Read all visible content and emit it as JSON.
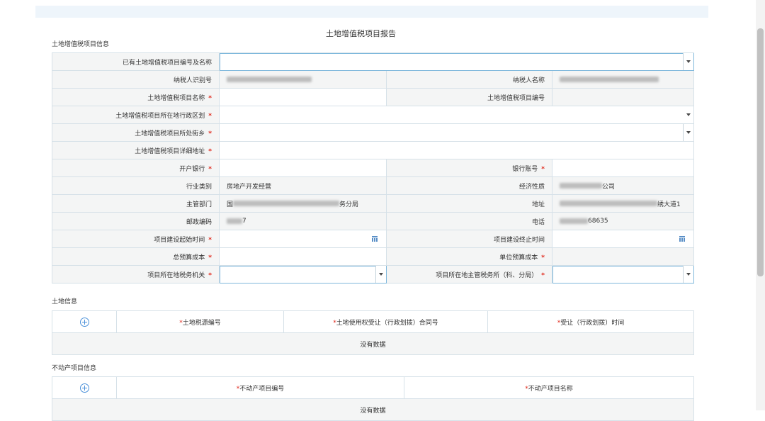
{
  "report_title": "土地增值税项目报告",
  "section_project": "土地增值税项目信息",
  "form": {
    "existing_project_label": "已有土地增值税项目编号及名称",
    "existing_project_value": "",
    "taxpayer_id_label": "纳税人识别号",
    "taxpayer_name_label": "纳税人名称",
    "taxpayer_name_suffix": "",
    "project_name_label": "土地增值税项目名称",
    "project_no_label": "土地增值税项目编号",
    "region_label": "土地增值税项目所在地行政区划",
    "street_label": "土地增值税项目所处街乡",
    "address_detail_label": "土地增值税项目详细地址",
    "bank_label": "开户银行",
    "bank_account_label": "银行账号",
    "industry_label": "行业类别",
    "industry_value": "房地产开发经营",
    "economy_label": "经济性质",
    "economy_suffix": "公司",
    "dept_label": "主管部门",
    "dept_prefix": "国",
    "dept_suffix": "务分局",
    "address_label": "地址",
    "address_suffix": "绣大道1",
    "postcode_label": "邮政编码",
    "postcode_suffix": "7",
    "phone_label": "电话",
    "phone_suffix": "68635",
    "start_date_label": "项目建设起始时间",
    "end_date_label": "项目建设终止时间",
    "total_budget_label": "总预算成本",
    "unit_budget_label": "单位预算成本",
    "tax_office_label": "项目所在地税务机关",
    "tax_bureau_label": "项目所在地主管税务所（科、分局）",
    "required_mark": "*"
  },
  "land_section": {
    "title": "土地信息",
    "columns": [
      "土地税源编号",
      "土地使用权受让（行政划拨）合同号",
      "受让（行政划拨）时间"
    ],
    "empty_text": "没有数据"
  },
  "property_section": {
    "title": "不动产项目信息",
    "columns": [
      "不动产项目编号",
      "不动产项目名称"
    ],
    "empty_text": "没有数据"
  }
}
